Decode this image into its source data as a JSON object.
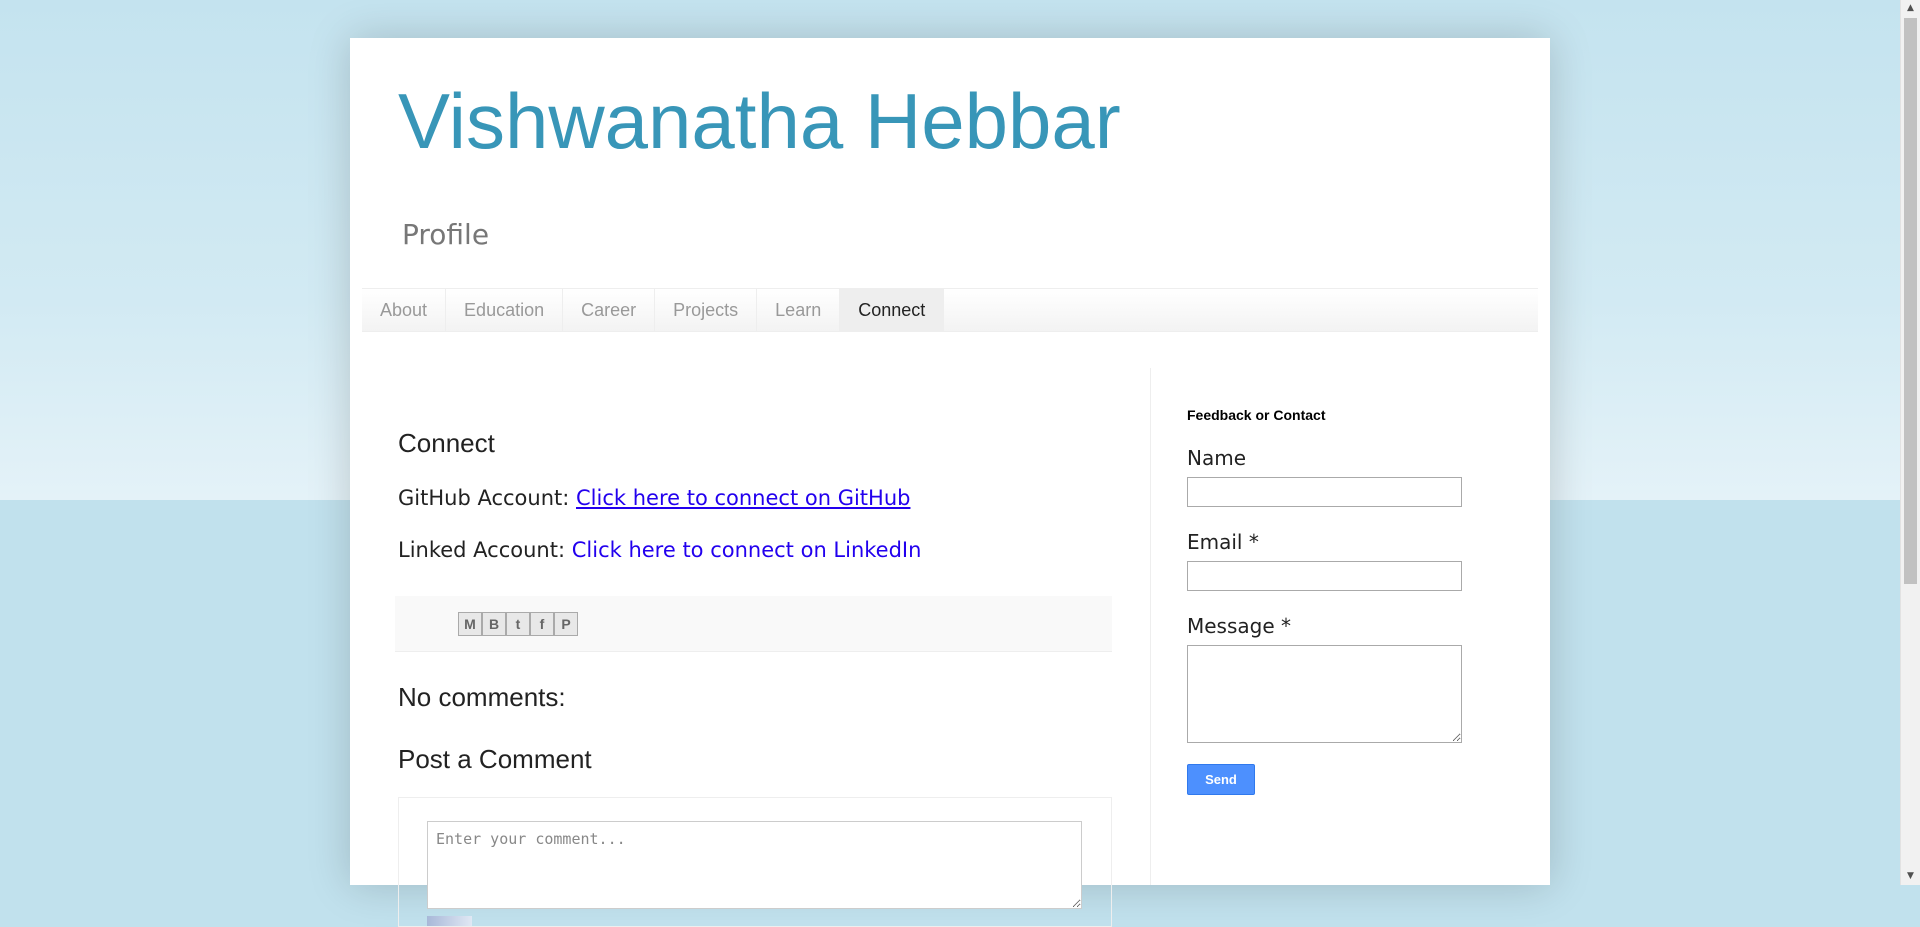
{
  "blog": {
    "title": "Vishwanatha Hebbar",
    "description": "Profile"
  },
  "tabs": [
    {
      "label": "About"
    },
    {
      "label": "Education"
    },
    {
      "label": "Career"
    },
    {
      "label": "Projects"
    },
    {
      "label": "Learn"
    },
    {
      "label": "Connect",
      "selected": true
    }
  ],
  "post": {
    "title": "Connect",
    "github_label": "GitHub Account: ",
    "github_link": "Click here to connect on GitHub",
    "linkedin_label": "Linked Account: ",
    "linkedin_link": "Click here to connect on LinkedIn"
  },
  "share": {
    "icons": [
      "email-icon",
      "blogger-icon",
      "twitter-icon",
      "facebook-icon",
      "pinterest-icon"
    ],
    "glyphs": [
      "M",
      "B",
      "t",
      "f",
      "P"
    ]
  },
  "comments": {
    "count_label": "No comments:",
    "post_title": "Post a Comment",
    "placeholder": "Enter your comment..."
  },
  "sidebar": {
    "widget_title": "Feedback or Contact",
    "name_label": "Name",
    "email_label": "Email *",
    "message_label": "Message *",
    "send_label": "Send"
  },
  "colors": {
    "title": "#3896b8",
    "link": "#2200ee",
    "button": "#4d90fe",
    "background": "#c1e1ed"
  }
}
